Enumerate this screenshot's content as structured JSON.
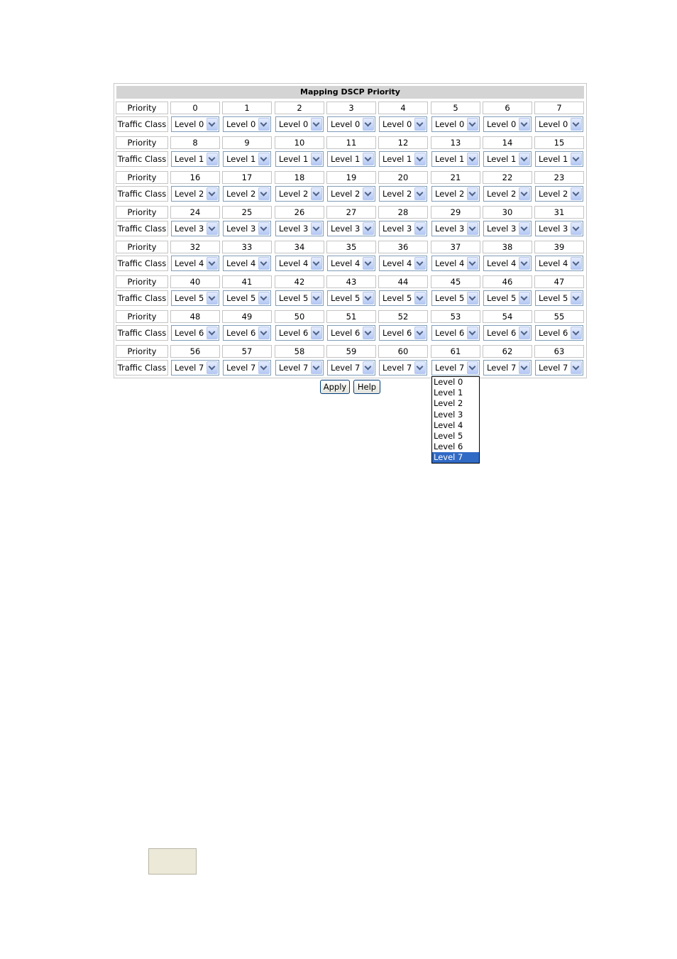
{
  "table": {
    "title": "Mapping DSCP Priority",
    "priority_label": "Priority",
    "traffic_label": "Traffic Class",
    "groups": [
      {
        "priorities": [
          "0",
          "1",
          "2",
          "3",
          "4",
          "5",
          "6",
          "7"
        ],
        "levels": [
          "Level 0",
          "Level 0",
          "Level 0",
          "Level 0",
          "Level 0",
          "Level 0",
          "Level 0",
          "Level 0"
        ]
      },
      {
        "priorities": [
          "8",
          "9",
          "10",
          "11",
          "12",
          "13",
          "14",
          "15"
        ],
        "levels": [
          "Level 1",
          "Level 1",
          "Level 1",
          "Level 1",
          "Level 1",
          "Level 1",
          "Level 1",
          "Level 1"
        ]
      },
      {
        "priorities": [
          "16",
          "17",
          "18",
          "19",
          "20",
          "21",
          "22",
          "23"
        ],
        "levels": [
          "Level 2",
          "Level 2",
          "Level 2",
          "Level 2",
          "Level 2",
          "Level 2",
          "Level 2",
          "Level 2"
        ]
      },
      {
        "priorities": [
          "24",
          "25",
          "26",
          "27",
          "28",
          "29",
          "30",
          "31"
        ],
        "levels": [
          "Level 3",
          "Level 3",
          "Level 3",
          "Level 3",
          "Level 3",
          "Level 3",
          "Level 3",
          "Level 3"
        ]
      },
      {
        "priorities": [
          "32",
          "33",
          "34",
          "35",
          "36",
          "37",
          "38",
          "39"
        ],
        "levels": [
          "Level 4",
          "Level 4",
          "Level 4",
          "Level 4",
          "Level 4",
          "Level 4",
          "Level 4",
          "Level 4"
        ]
      },
      {
        "priorities": [
          "40",
          "41",
          "42",
          "43",
          "44",
          "45",
          "46",
          "47"
        ],
        "levels": [
          "Level 5",
          "Level 5",
          "Level 5",
          "Level 5",
          "Level 5",
          "Level 5",
          "Level 5",
          "Level 5"
        ]
      },
      {
        "priorities": [
          "48",
          "49",
          "50",
          "51",
          "52",
          "53",
          "54",
          "55"
        ],
        "levels": [
          "Level 6",
          "Level 6",
          "Level 6",
          "Level 6",
          "Level 6",
          "Level 6",
          "Level 6",
          "Level 6"
        ]
      },
      {
        "priorities": [
          "56",
          "57",
          "58",
          "59",
          "60",
          "61",
          "62",
          "63"
        ],
        "levels": [
          "Level 7",
          "Level 7",
          "Level 7",
          "Level 7",
          "Level 7",
          "Level 7",
          "Level 7",
          "Level 7"
        ]
      }
    ]
  },
  "buttons": {
    "apply": "Apply",
    "help": "Help"
  },
  "dropdown": {
    "options": [
      "Level 0",
      "Level 1",
      "Level 2",
      "Level 3",
      "Level 4",
      "Level 5",
      "Level 6",
      "Level 7"
    ],
    "selected": "Level 7"
  },
  "colors": {
    "highlight": "#316ac5",
    "title_bg": "#d4d4d4",
    "select_border": "#7f9db9"
  }
}
